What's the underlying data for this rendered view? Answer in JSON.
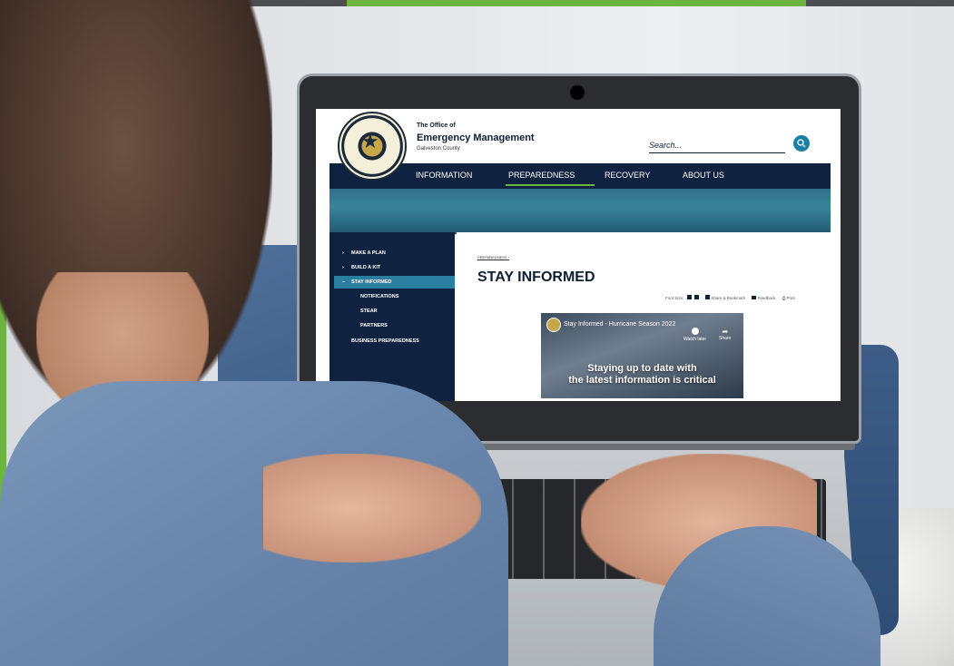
{
  "site": {
    "office_of": "The Office of",
    "org_name": "Emergency Management",
    "county": "Galveston County",
    "search_placeholder": "Search..."
  },
  "nav": {
    "items": [
      "INFORMATION",
      "PREPAREDNESS",
      "RECOVERY",
      "ABOUT US"
    ],
    "active": "PREPAREDNESS"
  },
  "sidebar": {
    "items": [
      {
        "label": "MAKE A PLAN",
        "marker": "›"
      },
      {
        "label": "BUILD A KIT",
        "marker": "›"
      },
      {
        "label": "STAY INFORMED",
        "marker": "–"
      },
      {
        "label": "NOTIFICATIONS"
      },
      {
        "label": "STEAR"
      },
      {
        "label": "PARTNERS"
      },
      {
        "label": "BUSINESS PREPAREDNESS"
      }
    ],
    "active": "STAY INFORMED"
  },
  "main": {
    "breadcrumb": "PREPAREDNESS ›",
    "title": "STAY INFORMED",
    "tools": {
      "font_size": "Font Size:",
      "share": "Share & Bookmark",
      "feedback": "Feedback",
      "print": "Print"
    }
  },
  "video": {
    "title": "Stay Informed - Hurricane Season 2022",
    "watch_later": "Watch later",
    "share": "Share",
    "caption_line1": "Staying up to date with",
    "caption_line2": "the latest information is critical"
  },
  "colors": {
    "navy": "#0f2340",
    "teal": "#2a7ea0",
    "green": "#6cb33f"
  }
}
